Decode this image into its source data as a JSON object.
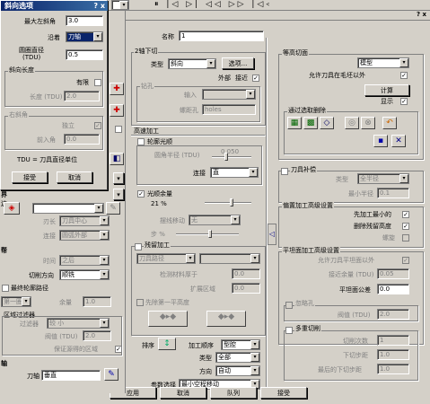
{
  "top_toolbar": {
    "playback_icons": [
      "⏸",
      "|◁",
      "▷|",
      "◁◁",
      "▷▷",
      "|◁◁",
      "▷▷|"
    ],
    "help": "? x"
  },
  "popup": {
    "title": "斜向选项",
    "title_close": "? x",
    "max_angle_label": "最大左斜角",
    "max_angle_value": "3.0",
    "along_label": "沿着",
    "along_value": "刀轴",
    "circle_dia_label": "圆圈直径",
    "circle_dia_sub": "(TDU)",
    "circle_dia_value": "0.5",
    "slope_len_title": "斜向长度",
    "limited_label": "有限",
    "length_label": "长度 (TDU)",
    "length_value": "2.0",
    "close_angle_title": "右斜角",
    "independent_label": "独立",
    "fwd_angle_label": "前入角",
    "fwd_angle_value": "0.0",
    "tdu_note": "TDU = 刀具直径单位",
    "accept": "接受",
    "cancel": "取消"
  },
  "left_panel": {
    "section1_title": "界",
    "section1_x": "边",
    "cut_label": "刃长",
    "cut_value": "刀具中心",
    "join_label": "连接",
    "join_value": "圆弧外部",
    "section2_title": "帮",
    "time_label": "时间",
    "time_value": "之后",
    "cut_dir_label": "切削方向",
    "cut_dir_value": "顺铣",
    "last_path_label": "最终轮廓路径",
    "first_cut_value": "第一圈高度",
    "margin_label": "余量",
    "margin_value": "1.0",
    "filter_title": "区域过滤器",
    "filter_label": "过滤器",
    "filter_value": "较 小",
    "threshold_label": "阀值 (TDU)",
    "threshold_value": "2.0",
    "keep_label": "保证源得的区域",
    "axis_title": "轴",
    "tool_axis_label": "刀轴",
    "tool_axis_value": "垂直"
  },
  "main": {
    "name_label": "名称",
    "name_value": "1",
    "helpbtn": "? x",
    "twod_title": "2轴下切",
    "type_label": "类型",
    "type_value": "斜向",
    "options_btn": "选项...",
    "outer_label": "外部",
    "close_label": "接近",
    "hole_title": "钻孔",
    "input_label": "输入",
    "input_value": "",
    "holes_label": "螺距孔",
    "holes_value": "holes",
    "hispeed_title": "高速加工",
    "contour_smooth": "轮廓光顺",
    "radius_label": "圆角半径 (TDU)",
    "radius_value": "0.050",
    "connect_label": "连接",
    "connect_value": "直",
    "smooth_remain": "光顺余量",
    "smooth_pct": "21 %",
    "trochoid_label": "摆线移动",
    "trochoid_value": "无",
    "step_label": "步 %",
    "residual_title": "残留加工",
    "tool_path_label": "刀具路径",
    "detect_thick_label": "检测材料厚于",
    "detect_thick_value": "0.0",
    "extend_label": "扩展区域",
    "extend_value": "0.0",
    "pre_cut_label": "先除第一平高度",
    "order_label": "排序",
    "order_icon": "↕",
    "machining_order_label": "加工顺序",
    "machining_order_value": "型腔",
    "type2_label": "类型",
    "type2_value": "全部",
    "direction_label": "方向",
    "direction_value": "自动",
    "param_label": "参数选择",
    "param_value": "最小空程移动"
  },
  "right": {
    "contour_title": "等高切面",
    "contour_value": "模型",
    "allow_outside_label": "允许刀具在毛坯以外",
    "calc_btn": "计算",
    "show_label": "显示",
    "select_del_title": "通过选取删除",
    "tool_comp_title": "刀具补偿",
    "tc_type_label": "类型",
    "tc_type_value": "全半径",
    "tc_min_label": "最小半径",
    "tc_min_value": "0.1",
    "offset_adv_title": "偏置加工高级设置",
    "min_first_label": "先加工最小的",
    "remove_dup_label": "删除残留高度",
    "slope_label": "螺旋",
    "plane_adv_title": "平坦面加工高级设置",
    "allow_plane_label": "允许刀具平坦面以外",
    "near_margin_label": "接近余量 (TDU)",
    "near_margin_value": "0.05",
    "plane_tol_label": "平坦面公差",
    "plane_tol_value": "0.0",
    "ignore_hole_label": "忽略孔",
    "threshold2_label": "阀值 (TDU)",
    "threshold2_value": "2.0",
    "multi_cut_title": "多重切削",
    "cut_count_label": "切削次数",
    "cut_count_value": "1",
    "step_down_label": "下切步距",
    "step_down_value": "1.0",
    "last_step_label": "最后的下切步距",
    "last_step_value": "1.0"
  },
  "bottom": {
    "apply": "应用",
    "cancel": "取消",
    "queue": "队列",
    "accept": "接受"
  }
}
